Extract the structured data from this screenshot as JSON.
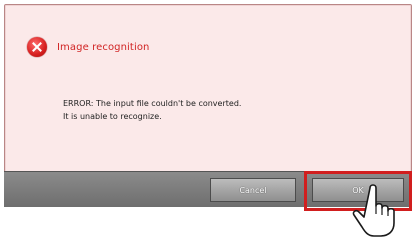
{
  "dialog": {
    "title": "Image recognition",
    "message_lines": [
      "ERROR: The input file couldn't be converted.",
      "It is unable to recognize."
    ]
  },
  "buttons": {
    "cancel_label": "Cancel",
    "ok_label": "OK"
  },
  "icons": {
    "error": "error-icon",
    "pointer": "pointing-hand-icon"
  },
  "colors": {
    "dialog_background": "#fbe9e9",
    "title": "#d12424",
    "highlight": "#d11e1e",
    "button_bar": "#7a7a7a"
  }
}
